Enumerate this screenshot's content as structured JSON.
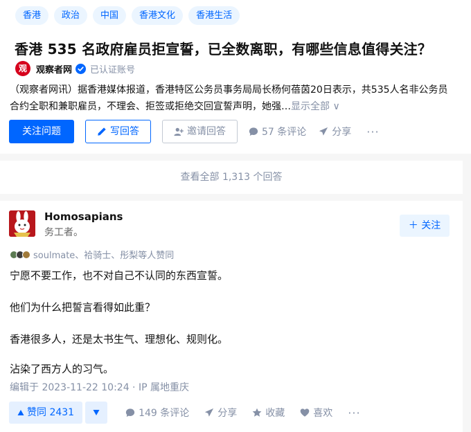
{
  "topics": [
    "香港",
    "政治",
    "中国",
    "香港文化",
    "香港生活"
  ],
  "question": {
    "title": "香港 535 名政府雇员拒宣誓，已全数离职，有哪些信息值得关注？",
    "author": {
      "logo_char": "观",
      "name": "观察者网",
      "verified_label": "已认证账号"
    },
    "excerpt_line1": "（观察者网讯）据香港媒体报道，香港特区公务员事务局局长杨何蓓茵20日表示，共535人名非公务员",
    "excerpt_line2": "合约全职和兼职雇员，不理会、拒签或拒绝交回宣誓声明，她强…",
    "show_all": "显示全部 ∨",
    "actions": {
      "follow": "关注问题",
      "write": "写回答",
      "invite": "邀请回答",
      "comments": "57 条评论",
      "share": "分享",
      "more": "···"
    }
  },
  "view_all_answers": "查看全部 1,313 个回答",
  "answer": {
    "author_name": "Homosapians",
    "author_bio": "务工者。",
    "follow": "关注",
    "upvoters": "soulmate、袷骑士、彤梨等人赞同",
    "paragraphs": [
      "宁愿不要工作，也不对自己不认同的东西宣誓。",
      "他们为什么把誓言看得如此重？",
      "香港很多人，还是太书生气、理想化、规则化。",
      "沾染了西方人的习气。"
    ],
    "meta": "编辑于 2023-11-22 10:24 · IP 属地重庆",
    "actions": {
      "upvote": "赞同 2431",
      "comments": "149 条评论",
      "share": "分享",
      "collect": "收藏",
      "like": "喜欢",
      "more": "···"
    }
  },
  "colors": {
    "accent": "#0066ff",
    "muted": "#8590a6",
    "tag_bg": "#ebf5ff"
  }
}
